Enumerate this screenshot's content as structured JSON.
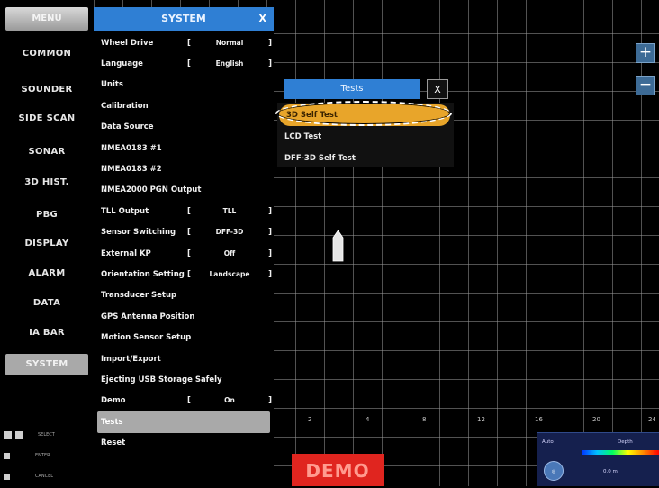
{
  "left_menu": {
    "header": "MENU",
    "items": [
      "COMMON",
      "SOUNDER",
      "SIDE SCAN",
      "SONAR",
      "3D HIST.",
      "PBG",
      "DISPLAY",
      "ALARM",
      "DATA",
      "IA BAR",
      "SYSTEM"
    ],
    "active": "SYSTEM",
    "legend": [
      "SELECT",
      "ENTER",
      "CANCEL"
    ]
  },
  "system_panel": {
    "title": "SYSTEM",
    "close": "X",
    "rows": [
      {
        "label": "Wheel Drive",
        "value": "Normal"
      },
      {
        "label": "Language",
        "value": "English"
      },
      {
        "label": "Units",
        "value": ""
      },
      {
        "label": "Calibration",
        "value": ""
      },
      {
        "label": "Data Source",
        "value": ""
      },
      {
        "label": "NMEA0183 #1",
        "value": ""
      },
      {
        "label": "NMEA0183 #2",
        "value": ""
      },
      {
        "label": "NMEA2000 PGN Output",
        "value": ""
      },
      {
        "label": "TLL Output",
        "value": "TLL"
      },
      {
        "label": "Sensor Switching",
        "value": "DFF-3D"
      },
      {
        "label": "External KP",
        "value": "Off"
      },
      {
        "label": "Orientation Setting",
        "value": "Landscape"
      },
      {
        "label": "Transducer Setup",
        "value": ""
      },
      {
        "label": "GPS Antenna Position",
        "value": ""
      },
      {
        "label": "Motion Sensor Setup",
        "value": ""
      },
      {
        "label": "Import/Export",
        "value": ""
      },
      {
        "label": "Ejecting USB Storage Safely",
        "value": ""
      },
      {
        "label": "Demo",
        "value": "On"
      },
      {
        "label": "Tests",
        "value": ""
      },
      {
        "label": "Reset",
        "value": ""
      }
    ],
    "selected": "Tests"
  },
  "tests_popup": {
    "title": "Tests",
    "close": "X",
    "items": [
      "3D Self Test",
      "LCD Test",
      "DFF-3D Self Test"
    ],
    "highlighted": "3D Self Test"
  },
  "zoom": {
    "plus": "+",
    "minus": "−"
  },
  "scale_labels": [
    "2",
    "4",
    "8",
    "12",
    "16",
    "20",
    "24"
  ],
  "demo_label": "DEMO",
  "corner_panel": {
    "mode": "Auto",
    "range_label": "Depth",
    "depth_value": "0.0 m"
  },
  "colors": {
    "accent_blue": "#2f7fd4",
    "highlight_orange": "#e8a52a",
    "demo_red": "#e0251f",
    "menu_gray": "#a9a9a9"
  }
}
